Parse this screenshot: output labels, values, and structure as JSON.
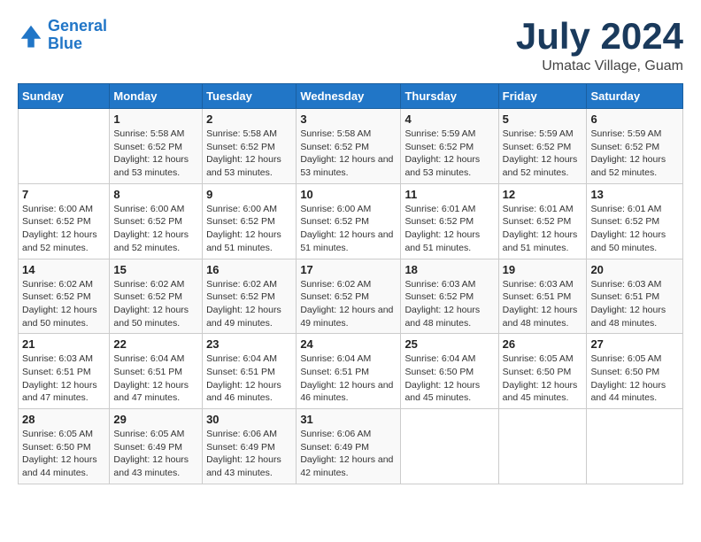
{
  "header": {
    "logo_line1": "General",
    "logo_line2": "Blue",
    "title": "July 2024",
    "subtitle": "Umatac Village, Guam"
  },
  "columns": [
    "Sunday",
    "Monday",
    "Tuesday",
    "Wednesday",
    "Thursday",
    "Friday",
    "Saturday"
  ],
  "weeks": [
    [
      {
        "day": "",
        "sunrise": "",
        "sunset": "",
        "daylight": ""
      },
      {
        "day": "1",
        "sunrise": "Sunrise: 5:58 AM",
        "sunset": "Sunset: 6:52 PM",
        "daylight": "Daylight: 12 hours and 53 minutes."
      },
      {
        "day": "2",
        "sunrise": "Sunrise: 5:58 AM",
        "sunset": "Sunset: 6:52 PM",
        "daylight": "Daylight: 12 hours and 53 minutes."
      },
      {
        "day": "3",
        "sunrise": "Sunrise: 5:58 AM",
        "sunset": "Sunset: 6:52 PM",
        "daylight": "Daylight: 12 hours and 53 minutes."
      },
      {
        "day": "4",
        "sunrise": "Sunrise: 5:59 AM",
        "sunset": "Sunset: 6:52 PM",
        "daylight": "Daylight: 12 hours and 53 minutes."
      },
      {
        "day": "5",
        "sunrise": "Sunrise: 5:59 AM",
        "sunset": "Sunset: 6:52 PM",
        "daylight": "Daylight: 12 hours and 52 minutes."
      },
      {
        "day": "6",
        "sunrise": "Sunrise: 5:59 AM",
        "sunset": "Sunset: 6:52 PM",
        "daylight": "Daylight: 12 hours and 52 minutes."
      }
    ],
    [
      {
        "day": "7",
        "sunrise": "Sunrise: 6:00 AM",
        "sunset": "Sunset: 6:52 PM",
        "daylight": "Daylight: 12 hours and 52 minutes."
      },
      {
        "day": "8",
        "sunrise": "Sunrise: 6:00 AM",
        "sunset": "Sunset: 6:52 PM",
        "daylight": "Daylight: 12 hours and 52 minutes."
      },
      {
        "day": "9",
        "sunrise": "Sunrise: 6:00 AM",
        "sunset": "Sunset: 6:52 PM",
        "daylight": "Daylight: 12 hours and 51 minutes."
      },
      {
        "day": "10",
        "sunrise": "Sunrise: 6:00 AM",
        "sunset": "Sunset: 6:52 PM",
        "daylight": "Daylight: 12 hours and 51 minutes."
      },
      {
        "day": "11",
        "sunrise": "Sunrise: 6:01 AM",
        "sunset": "Sunset: 6:52 PM",
        "daylight": "Daylight: 12 hours and 51 minutes."
      },
      {
        "day": "12",
        "sunrise": "Sunrise: 6:01 AM",
        "sunset": "Sunset: 6:52 PM",
        "daylight": "Daylight: 12 hours and 51 minutes."
      },
      {
        "day": "13",
        "sunrise": "Sunrise: 6:01 AM",
        "sunset": "Sunset: 6:52 PM",
        "daylight": "Daylight: 12 hours and 50 minutes."
      }
    ],
    [
      {
        "day": "14",
        "sunrise": "Sunrise: 6:02 AM",
        "sunset": "Sunset: 6:52 PM",
        "daylight": "Daylight: 12 hours and 50 minutes."
      },
      {
        "day": "15",
        "sunrise": "Sunrise: 6:02 AM",
        "sunset": "Sunset: 6:52 PM",
        "daylight": "Daylight: 12 hours and 50 minutes."
      },
      {
        "day": "16",
        "sunrise": "Sunrise: 6:02 AM",
        "sunset": "Sunset: 6:52 PM",
        "daylight": "Daylight: 12 hours and 49 minutes."
      },
      {
        "day": "17",
        "sunrise": "Sunrise: 6:02 AM",
        "sunset": "Sunset: 6:52 PM",
        "daylight": "Daylight: 12 hours and 49 minutes."
      },
      {
        "day": "18",
        "sunrise": "Sunrise: 6:03 AM",
        "sunset": "Sunset: 6:52 PM",
        "daylight": "Daylight: 12 hours and 48 minutes."
      },
      {
        "day": "19",
        "sunrise": "Sunrise: 6:03 AM",
        "sunset": "Sunset: 6:51 PM",
        "daylight": "Daylight: 12 hours and 48 minutes."
      },
      {
        "day": "20",
        "sunrise": "Sunrise: 6:03 AM",
        "sunset": "Sunset: 6:51 PM",
        "daylight": "Daylight: 12 hours and 48 minutes."
      }
    ],
    [
      {
        "day": "21",
        "sunrise": "Sunrise: 6:03 AM",
        "sunset": "Sunset: 6:51 PM",
        "daylight": "Daylight: 12 hours and 47 minutes."
      },
      {
        "day": "22",
        "sunrise": "Sunrise: 6:04 AM",
        "sunset": "Sunset: 6:51 PM",
        "daylight": "Daylight: 12 hours and 47 minutes."
      },
      {
        "day": "23",
        "sunrise": "Sunrise: 6:04 AM",
        "sunset": "Sunset: 6:51 PM",
        "daylight": "Daylight: 12 hours and 46 minutes."
      },
      {
        "day": "24",
        "sunrise": "Sunrise: 6:04 AM",
        "sunset": "Sunset: 6:51 PM",
        "daylight": "Daylight: 12 hours and 46 minutes."
      },
      {
        "day": "25",
        "sunrise": "Sunrise: 6:04 AM",
        "sunset": "Sunset: 6:50 PM",
        "daylight": "Daylight: 12 hours and 45 minutes."
      },
      {
        "day": "26",
        "sunrise": "Sunrise: 6:05 AM",
        "sunset": "Sunset: 6:50 PM",
        "daylight": "Daylight: 12 hours and 45 minutes."
      },
      {
        "day": "27",
        "sunrise": "Sunrise: 6:05 AM",
        "sunset": "Sunset: 6:50 PM",
        "daylight": "Daylight: 12 hours and 44 minutes."
      }
    ],
    [
      {
        "day": "28",
        "sunrise": "Sunrise: 6:05 AM",
        "sunset": "Sunset: 6:50 PM",
        "daylight": "Daylight: 12 hours and 44 minutes."
      },
      {
        "day": "29",
        "sunrise": "Sunrise: 6:05 AM",
        "sunset": "Sunset: 6:49 PM",
        "daylight": "Daylight: 12 hours and 43 minutes."
      },
      {
        "day": "30",
        "sunrise": "Sunrise: 6:06 AM",
        "sunset": "Sunset: 6:49 PM",
        "daylight": "Daylight: 12 hours and 43 minutes."
      },
      {
        "day": "31",
        "sunrise": "Sunrise: 6:06 AM",
        "sunset": "Sunset: 6:49 PM",
        "daylight": "Daylight: 12 hours and 42 minutes."
      },
      {
        "day": "",
        "sunrise": "",
        "sunset": "",
        "daylight": ""
      },
      {
        "day": "",
        "sunrise": "",
        "sunset": "",
        "daylight": ""
      },
      {
        "day": "",
        "sunrise": "",
        "sunset": "",
        "daylight": ""
      }
    ]
  ]
}
